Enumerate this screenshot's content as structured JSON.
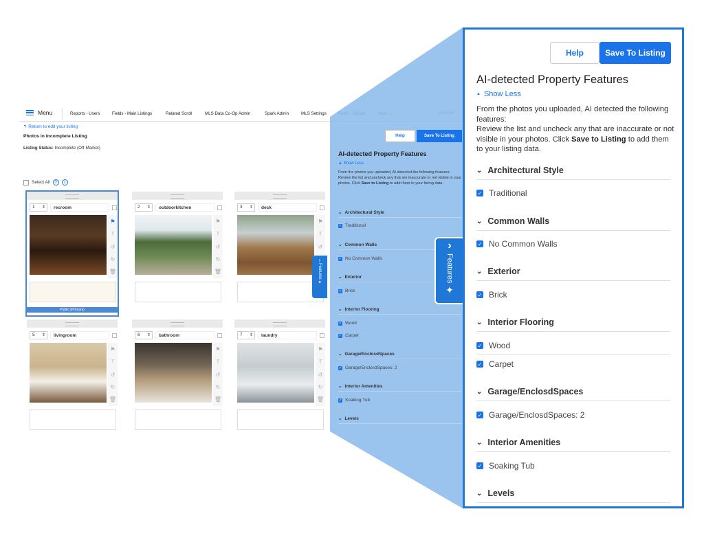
{
  "nav": {
    "menu_label": "Menu",
    "items": [
      "Reports - Users",
      "Fields - Main Listings",
      "Related Scroll",
      "MLS Data Co-Op Admin",
      "Spark Admin",
      "MLS Settings",
      "Fields - Details",
      "More"
    ],
    "reorder": "Reorder..."
  },
  "page": {
    "back_link": "Return to edit your listing",
    "title": "Photos in Incomplete Listing",
    "status_label": "Listing Status:",
    "status_value": "Incomplete (Off-Market)",
    "select_all": "Select All"
  },
  "photos": [
    {
      "order": "1",
      "label": "recroom"
    },
    {
      "order": "2",
      "label": "outdoorkitchen"
    },
    {
      "order": "3",
      "label": "deck"
    },
    {
      "order": "5",
      "label": "livingroom"
    },
    {
      "order": "6",
      "label": "bathroom"
    },
    {
      "order": "7",
      "label": "laundry"
    }
  ],
  "primary_badge": "Public (Primary)",
  "features_tab": "Features",
  "panel": {
    "help": "Help",
    "save": "Save To Listing",
    "title": "AI-detected Property Features",
    "show_less": "Show Less",
    "desc_1": "From the photos you uploaded, AI detected the following features:",
    "desc_2": "Review the list and uncheck any that are inaccurate or not visible in your photos. Click ",
    "desc_bold": "Save to Listing",
    "desc_3": " to add them to your listing data.",
    "sections": [
      {
        "name": "Architectural Style",
        "options": [
          "Traditional"
        ]
      },
      {
        "name": "Common Walls",
        "options": [
          "No Common Walls"
        ]
      },
      {
        "name": "Exterior",
        "options": [
          "Brick"
        ]
      },
      {
        "name": "Interior Flooring",
        "options": [
          "Wood",
          "Carpet"
        ]
      },
      {
        "name": "Garage/EnclosdSpaces",
        "options": [
          "Garage/EnclosdSpaces: 2"
        ]
      },
      {
        "name": "Interior Amenities",
        "options": [
          "Soaking Tub"
        ]
      },
      {
        "name": "Levels",
        "options": []
      }
    ]
  },
  "colors": {
    "accent": "#1a73e8",
    "panel_border": "#1f78d6",
    "callout": "#8fbcec"
  }
}
